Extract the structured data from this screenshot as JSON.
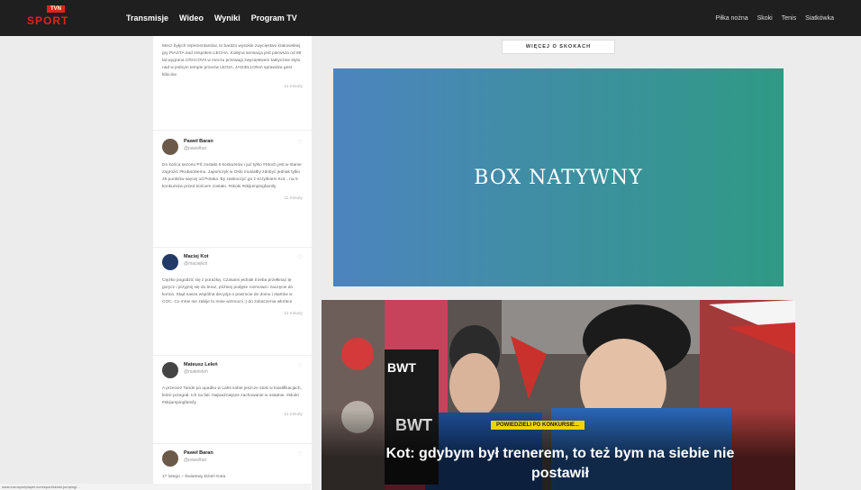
{
  "header": {
    "logo_tvn": "TVN",
    "logo_sport": "SPORT",
    "nav_main": [
      "Transmisje",
      "Wideo",
      "Wyniki",
      "Program TV"
    ],
    "nav_right": [
      "Piłka nożna",
      "Skoki",
      "Tenis",
      "Siatkówka"
    ]
  },
  "sidebar": {
    "tweets": [
      {
        "body": "Mecz byłych reprezentantów, to bardzo wysokie zwycięstwo krakowskiej gry PIASTA nad zespołem LECHA. Kolejna sensacja jest pierwsza od 68 lat wygrana CRACOVII w meczu przewagi zwycięstwem taktycznie stylu nad w jednym tempie przeciw LEGIA, JAGIELLONIA sprawdza gest kibiców.",
        "time": "11 minuty"
      },
      {
        "name": "Paweł Baran",
        "handle": "@pawelbar",
        "body": "Do końca sezonu PŚ zostało 6 konkursów i już tylko #Stoch jest w stanie zagrozić #Kubackiemu. Japończyk w Oslo musiałby zdobyć jednak tylko 25 punktów więcej od Polaka. By zaskoczyć go z Krzyśkiem Kot... na 5 konkursów przed końcem zostało. #skoki #skijumpingfamily",
        "time": "11 minuty"
      },
      {
        "name": "Maciej Kot",
        "handle": "@maciejkot",
        "body": "Ciężko pogodzić się z porażką. Czasami jednak trzeba przełknąć tę gorycz i przyjmij się do teraz, później podjęte rozmowa i zaczęcie do końca. Stąd nasza wspólna decyzja o powrocie do domu i startów w COC. Co mnie nie zabije to mnie wzmocni :) do zobaczenia wkrótce",
        "time": "11 minuty"
      },
      {
        "name": "Mateusz Leleń",
        "handle": "@mateleleń",
        "body": "A przecież Tande po upadku w Lahti sobie jeszcze stoki w kwalifikacjach, które przegrał. Ich na fali. Najważniejsze zachowanie w ostatnie. #skoki #skijumpingfamily",
        "time": "11 minuty"
      },
      {
        "name": "Paweł Baran",
        "handle": "@pawelbar",
        "body": "17 lutego – Światowy Dzień Kota",
        "time": ""
      }
    ]
  },
  "main": {
    "more_label": "WIĘCEJ O SKOKACH",
    "native_box": "BOX NATYWNY",
    "hero_badge": "POWIEDZIELI PO KONKURSIE...",
    "hero_headline": "Kot: gdybym był trenerem, to też bym na siebie nie postawił"
  },
  "status_url": "www.eurosportplayer.com/sport/sk/ski-jumping/..."
}
